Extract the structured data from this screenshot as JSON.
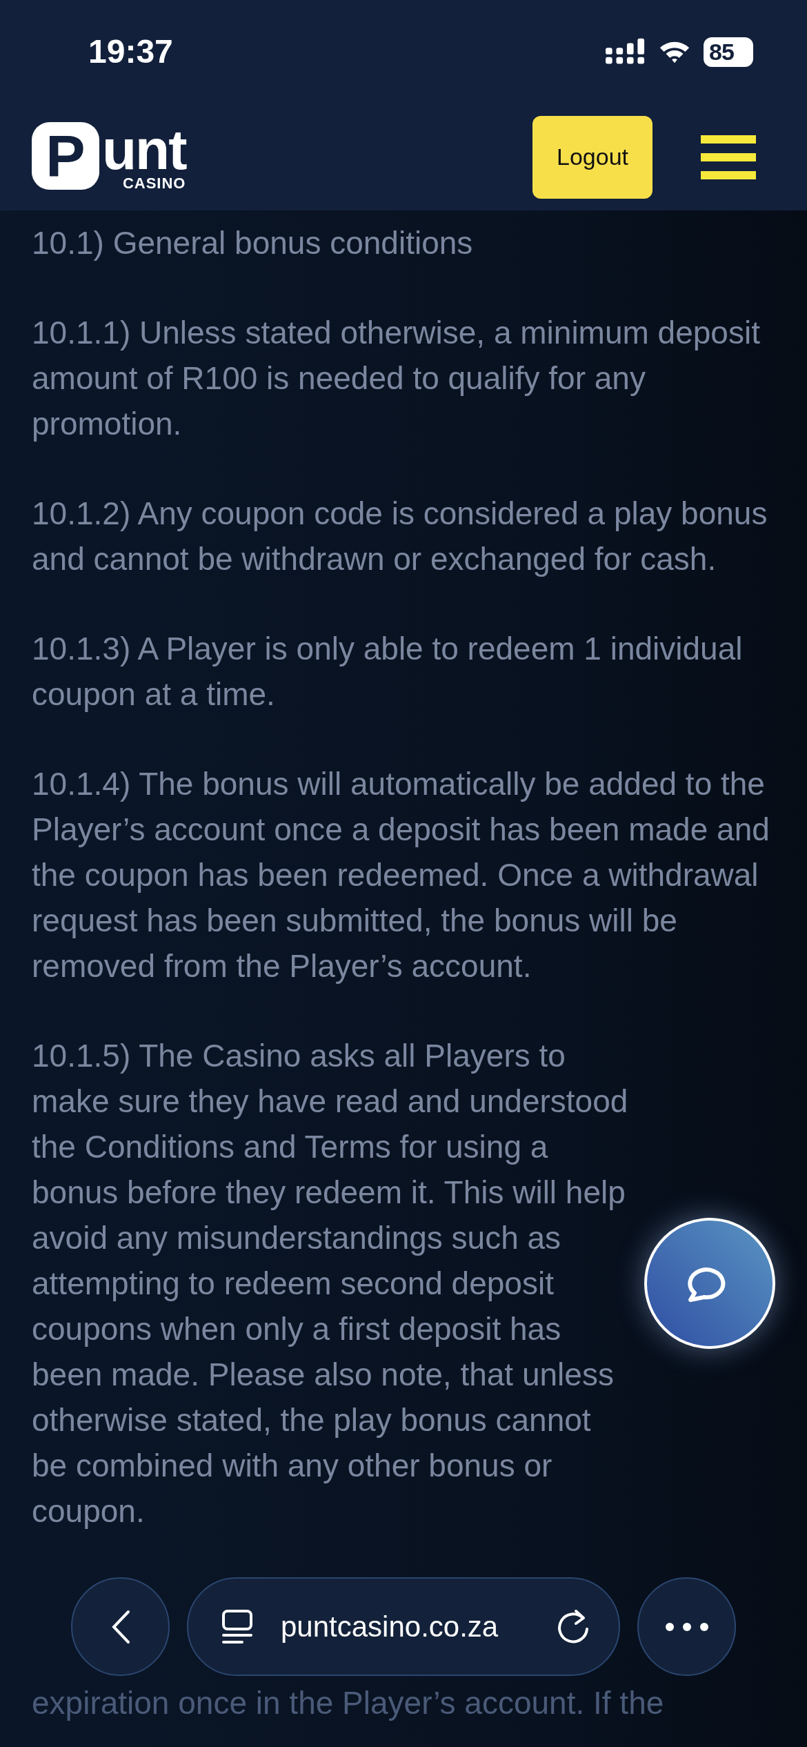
{
  "status_bar": {
    "time": "19:37",
    "battery": "85"
  },
  "header": {
    "logo": {
      "mark": "P",
      "wordmark": "unt",
      "tagline": "CASINO"
    },
    "logout_button": "Logout"
  },
  "paragraphs": [
    {
      "text": "10.1) General bonus conditions"
    },
    {
      "text": "10.1.1) Unless stated otherwise, a minimum deposit amount of R100 is needed to qualify for any promotion."
    },
    {
      "text": "10.1.2) Any coupon code is considered a play bonus and cannot be withdrawn or exchanged for cash."
    },
    {
      "text": "10.1.3) A Player is only able to redeem 1 individual coupon at a time."
    },
    {
      "text": "10.1.4) The bonus will automatically be added to the Player’s account once a deposit has been made and the coupon has been redeemed. Once a withdrawal request has been submitted, the bonus will be removed from the Player’s account."
    },
    {
      "text": "10.1.5) The Casino asks all Players to make sure they have read and understood the Conditions and Terms for using a bonus before they redeem it. This will help avoid any misunderstandings such as attempting to redeem second deposit coupons when only a first deposit has been made. Please also note, that unless otherwise stated, the play bonus cannot be combined with any other bonus or coupon."
    },
    {
      "text": "expiration once in the Player’s account. If the",
      "kind": "partial"
    }
  ],
  "browser_bar": {
    "url": "puntcasino.co.za"
  }
}
